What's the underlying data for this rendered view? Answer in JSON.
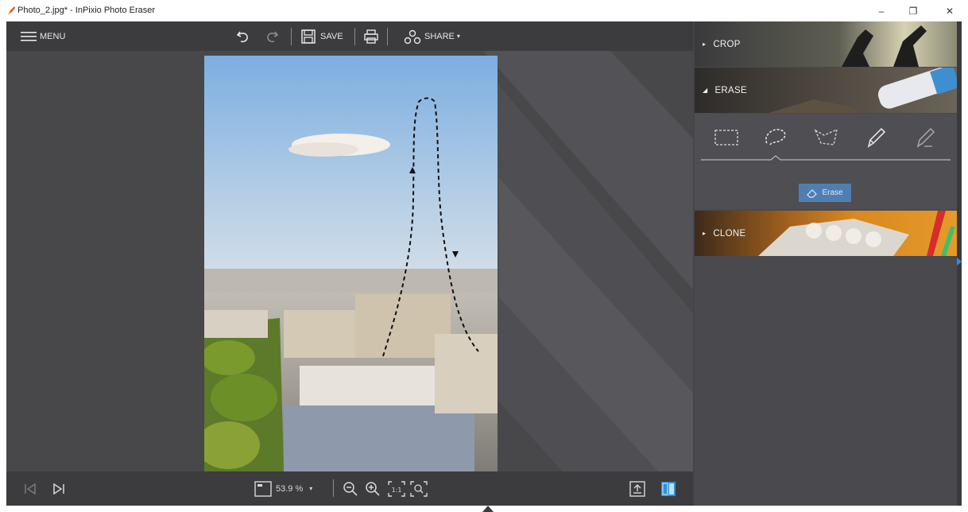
{
  "titlebar": {
    "title": "Photo_2.jpg* - InPixio Photo Eraser",
    "minimize": "–",
    "restore": "❐",
    "close": "✕"
  },
  "toolbar": {
    "menu_label": "MENU",
    "save_label": "SAVE",
    "share_label": "SHARE",
    "share_caret": "▾"
  },
  "bottombar": {
    "zoom_value": "53.9 %",
    "zoom_caret": "▾"
  },
  "panel": {
    "crop_label": "CROP",
    "erase_label": "ERASE",
    "clone_label": "CLONE",
    "erase_button_label": "Erase",
    "collapsed_marker": "▸",
    "expanded_marker": "◢"
  },
  "colors": {
    "accent": "#4f7fb2",
    "toolbar_bg": "#3c3b3e",
    "canvas_bg": "#48474a",
    "panel_bg": "#4a494d"
  }
}
